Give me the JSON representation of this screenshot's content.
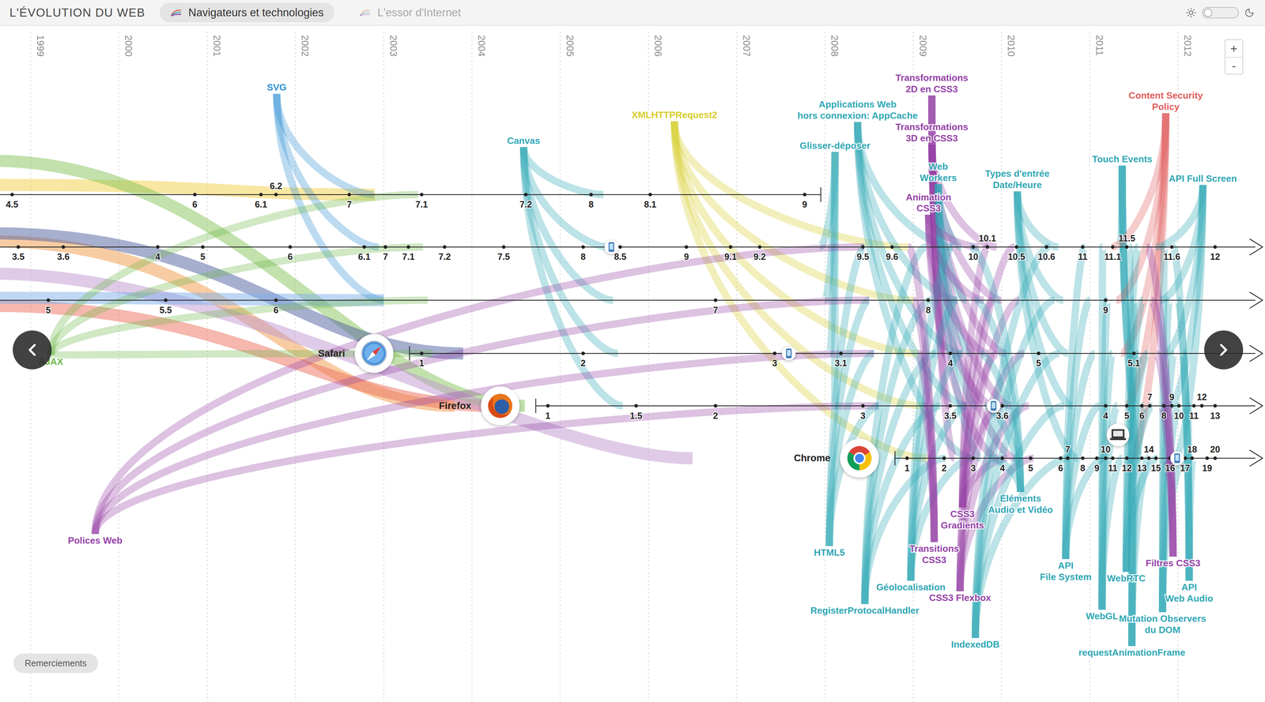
{
  "header": {
    "title": "L'ÉVOLUTION DU WEB",
    "tabs": [
      {
        "label": "Navigateurs et technologies",
        "selected": true
      },
      {
        "label": "L'essor d'Internet",
        "selected": false
      }
    ],
    "dark_mode": false
  },
  "chart": {
    "years": [
      "1999",
      "2000",
      "2001",
      "2002",
      "2003",
      "2004",
      "2005",
      "2006",
      "2007",
      "2008",
      "2009",
      "2010",
      "2011",
      "2012"
    ],
    "browsers": [
      {
        "discontinued": true,
        "devices": [],
        "versions": [
          {
            "label": "4.5",
            "date": 1998.79
          },
          {
            "label": "6",
            "date": 2000.86
          },
          {
            "label": "6.1",
            "date": 2001.61
          },
          {
            "label": "6.2",
            "date": 2001.78
          },
          {
            "label": "7",
            "date": 2002.61
          },
          {
            "label": "7.1",
            "date": 2003.43
          },
          {
            "label": "7.2",
            "date": 2004.61
          },
          {
            "label": "8",
            "date": 2005.35
          },
          {
            "label": "8.1",
            "date": 2006.02
          },
          {
            "label": "9",
            "date": 2007.77
          }
        ]
      },
      {
        "discontinued": false,
        "devices": [
          {
            "kind": "mobile",
            "date": 2005.58
          }
        ],
        "versions": [
          {
            "label": "3.5",
            "date": 1998.86
          },
          {
            "label": "3.6",
            "date": 1999.37
          },
          {
            "label": "4",
            "date": 2000.44
          },
          {
            "label": "5",
            "date": 2000.95
          },
          {
            "label": "6",
            "date": 2001.94
          },
          {
            "label": "6.1",
            "date": 2002.78
          },
          {
            "label": "7",
            "date": 2003.02
          },
          {
            "label": "7.1",
            "date": 2003.28
          },
          {
            "label": "7.2",
            "date": 2003.69
          },
          {
            "label": "7.5",
            "date": 2004.36
          },
          {
            "label": "8",
            "date": 2005.26
          },
          {
            "label": "8.5",
            "date": 2005.68
          },
          {
            "label": "9",
            "date": 2006.43
          },
          {
            "label": "9.1",
            "date": 2006.93
          },
          {
            "label": "9.2",
            "date": 2007.26
          },
          {
            "label": "9.5",
            "date": 2008.43
          },
          {
            "label": "9.6",
            "date": 2008.76
          },
          {
            "label": "10",
            "date": 2009.68
          },
          {
            "label": "10.1",
            "date": 2009.84
          },
          {
            "label": "10.5",
            "date": 2010.17
          },
          {
            "label": "10.6",
            "date": 2010.51
          },
          {
            "label": "11",
            "date": 2010.92
          },
          {
            "label": "11.1",
            "date": 2011.26
          },
          {
            "label": "11.5",
            "date": 2011.42
          },
          {
            "label": "11.6",
            "date": 2011.93
          },
          {
            "label": "12",
            "date": 2012.42
          }
        ]
      },
      {
        "discontinued": false,
        "devices": [],
        "versions": [
          {
            "label": "5",
            "date": 1999.2
          },
          {
            "label": "5.5",
            "date": 2000.53
          },
          {
            "label": "6",
            "date": 2001.78
          },
          {
            "label": "7",
            "date": 2006.76
          },
          {
            "label": "8",
            "date": 2009.17
          },
          {
            "label": "9",
            "date": 2011.18
          }
        ]
      },
      {
        "name": "Safari",
        "discontinued": false,
        "devices": [
          {
            "kind": "mobile",
            "date": 2007.59
          }
        ],
        "versions": [
          {
            "label": "1",
            "date": 2003.43
          },
          {
            "label": "2",
            "date": 2005.26
          },
          {
            "label": "3",
            "date": 2007.43
          },
          {
            "label": "3.1",
            "date": 2008.18
          },
          {
            "label": "4",
            "date": 2009.42
          },
          {
            "label": "5",
            "date": 2010.42
          },
          {
            "label": "5.1",
            "date": 2011.5
          }
        ]
      },
      {
        "name": "Firefox",
        "discontinued": false,
        "devices": [
          {
            "kind": "mobile",
            "date": 2009.91
          }
        ],
        "versions": [
          {
            "label": "1",
            "date": 2004.86
          },
          {
            "label": "1.5",
            "date": 2005.86
          },
          {
            "label": "2",
            "date": 2006.76
          },
          {
            "label": "3",
            "date": 2008.43
          },
          {
            "label": "3.5",
            "date": 2009.42
          },
          {
            "label": "3.6",
            "date": 2010.01
          },
          {
            "label": "4",
            "date": 2011.18
          },
          {
            "label": "5",
            "date": 2011.42
          },
          {
            "label": "6",
            "date": 2011.59
          },
          {
            "label": "7",
            "date": 2011.68
          },
          {
            "label": "8",
            "date": 2011.84
          },
          {
            "label": "9",
            "date": 2011.93
          },
          {
            "label": "10",
            "date": 2012.01
          },
          {
            "label": "11",
            "date": 2012.18
          },
          {
            "label": "12",
            "date": 2012.27
          },
          {
            "label": "13",
            "date": 2012.42
          }
        ]
      },
      {
        "name": "Chrome",
        "discontinued": false,
        "devices": [
          {
            "kind": "laptop",
            "date": 2011.32
          },
          {
            "kind": "mobile",
            "date": 2011.99
          }
        ],
        "versions": [
          {
            "label": "1",
            "date": 2008.93
          },
          {
            "label": "2",
            "date": 2009.35
          },
          {
            "label": "3",
            "date": 2009.68
          },
          {
            "label": "4",
            "date": 2010.01
          },
          {
            "label": "5",
            "date": 2010.33
          },
          {
            "label": "6",
            "date": 2010.67
          },
          {
            "label": "7",
            "date": 2010.75
          },
          {
            "label": "8",
            "date": 2010.92
          },
          {
            "label": "9",
            "date": 2011.08
          },
          {
            "label": "10",
            "date": 2011.18
          },
          {
            "label": "11",
            "date": 2011.26
          },
          {
            "label": "12",
            "date": 2011.42
          },
          {
            "label": "13",
            "date": 2011.59
          },
          {
            "label": "14",
            "date": 2011.67
          },
          {
            "label": "15",
            "date": 2011.75
          },
          {
            "label": "16",
            "date": 2011.91
          },
          {
            "label": "17",
            "date": 2012.08
          },
          {
            "label": "18",
            "date": 2012.16
          },
          {
            "label": "19",
            "date": 2012.33
          },
          {
            "label": "20",
            "date": 2012.42
          }
        ]
      }
    ],
    "technologies": [
      {
        "lines": [
          "SVG"
        ],
        "color": "#2f8fd4",
        "date": 2003.0
      },
      {
        "lines": [
          "Canvas"
        ],
        "color": "#2fa7b5",
        "date": 2005.6
      },
      {
        "lines": [
          "XMLHTTPRequest2"
        ],
        "color": "#d6cc2a",
        "date": 2009.0
      },
      {
        "lines": [
          "Applications Web",
          "hors connexion: AppCache"
        ],
        "color": "#2fa7b5",
        "date": 2009.5
      },
      {
        "lines": [
          "Glisser-déposer"
        ],
        "color": "#2fa7b5",
        "date": 2008.0
      },
      {
        "lines": [
          "Transformations",
          "2D en CSS3"
        ],
        "color": "#9441a6",
        "date": 2009.3
      },
      {
        "lines": [
          "Transformations",
          "3D en CSS3"
        ],
        "color": "#9441a6",
        "date": 2010.0
      },
      {
        "lines": [
          "Web",
          "Workers"
        ],
        "color": "#2fa7b5",
        "date": 2009.6
      },
      {
        "lines": [
          "Animation",
          "CSS3"
        ],
        "color": "#9441a6",
        "date": 2009.8
      },
      {
        "lines": [
          "Types d'entrée",
          "Date/Heure"
        ],
        "color": "#2fa7b5",
        "date": 2010.7
      },
      {
        "lines": [
          "Touch Events"
        ],
        "color": "#2fa7b5",
        "date": 2011.4
      },
      {
        "lines": [
          "Content Security",
          "Policy"
        ],
        "color": "#e05c5c",
        "date": 2011.3
      },
      {
        "lines": [
          "API Full Screen"
        ],
        "color": "#2fa7b5",
        "date": 2011.8
      },
      {
        "lines": [
          "AJAX"
        ],
        "color": "#6cb848",
        "date": 2003.5
      },
      {
        "lines": [
          "Polices Web"
        ],
        "color": "#9441a6",
        "date": 2008.5
      },
      {
        "lines": [
          "HTML5"
        ],
        "color": "#2fa7b5",
        "date": 2008.5
      },
      {
        "lines": [
          "RegisterProtocalHandler"
        ],
        "color": "#2fa7b5",
        "date": 2009.2
      },
      {
        "lines": [
          "Géolocalisation"
        ],
        "color": "#2fa7b5",
        "date": 2009.5
      },
      {
        "lines": [
          "Transitions",
          "CSS3"
        ],
        "color": "#9441a6",
        "date": 2009.0
      },
      {
        "lines": [
          "CSS3 Flexbox"
        ],
        "color": "#9441a6",
        "date": 2010.2
      },
      {
        "lines": [
          "CSS3",
          "Gradients"
        ],
        "color": "#9441a6",
        "date": 2009.9
      },
      {
        "lines": [
          "Éléments",
          "Audio et Vidéo"
        ],
        "color": "#2fa7b5",
        "date": 2009.7
      },
      {
        "lines": [
          "IndexedDB"
        ],
        "color": "#2fa7b5",
        "date": 2010.6
      },
      {
        "lines": [
          "API",
          "File System"
        ],
        "color": "#2fa7b5",
        "date": 2011.0
      },
      {
        "lines": [
          "WebGL"
        ],
        "color": "#2fa7b5",
        "date": 2011.2
      },
      {
        "lines": [
          "WebRTC"
        ],
        "color": "#2fa7b5",
        "date": 2011.6
      },
      {
        "lines": [
          "Mutation Observers",
          "du DOM"
        ],
        "color": "#2fa7b5",
        "date": 2011.9
      },
      {
        "lines": [
          "requestAnimationFrame"
        ],
        "color": "#2fa7b5",
        "date": 2011.5
      },
      {
        "lines": [
          "Filtres CSS3"
        ],
        "color": "#9441a6",
        "date": 2011.7
      },
      {
        "lines": [
          "API",
          "Web Audio"
        ],
        "color": "#2fa7b5",
        "date": 2012.0
      }
    ],
    "offscreen_ribbons": [
      {
        "color": "#f2cf45",
        "date": 2002.9,
        "row": 0
      },
      {
        "color": "#f29a48",
        "date": 2003.8,
        "row": 4
      },
      {
        "color": "#ec6f5e",
        "date": 2004.2,
        "row": 4
      },
      {
        "color": "#86c45a",
        "date": 2004.6,
        "row": 4
      },
      {
        "color": "#4f5fa0",
        "date": 2003.9,
        "row": 3
      },
      {
        "color": "#bf97d0",
        "date": 2006.5,
        "row": 5
      },
      {
        "color": "#7fb0ea",
        "date": 2003.0,
        "row": 2
      }
    ]
  },
  "zoom": [
    "+",
    "-"
  ],
  "footer_button": "Remerciements"
}
